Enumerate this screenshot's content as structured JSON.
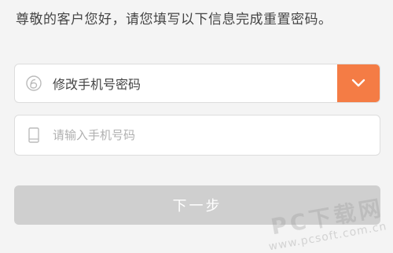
{
  "intro_text": "尊敬的客户您好，请您填写以下信息完成重置密码。",
  "type_field": {
    "value": "修改手机号密码",
    "icon": "phone-type-icon",
    "dropdown_icon": "chevron-down-icon",
    "dropdown_color": "#f47c45"
  },
  "phone_field": {
    "placeholder": "请输入手机号码",
    "icon": "mobile-phone-icon"
  },
  "next_button": {
    "label": "下一步",
    "color": "#cfcfcf"
  },
  "watermark": {
    "main": "PC下载网",
    "sub": "www.pcsoft.com.cn"
  }
}
